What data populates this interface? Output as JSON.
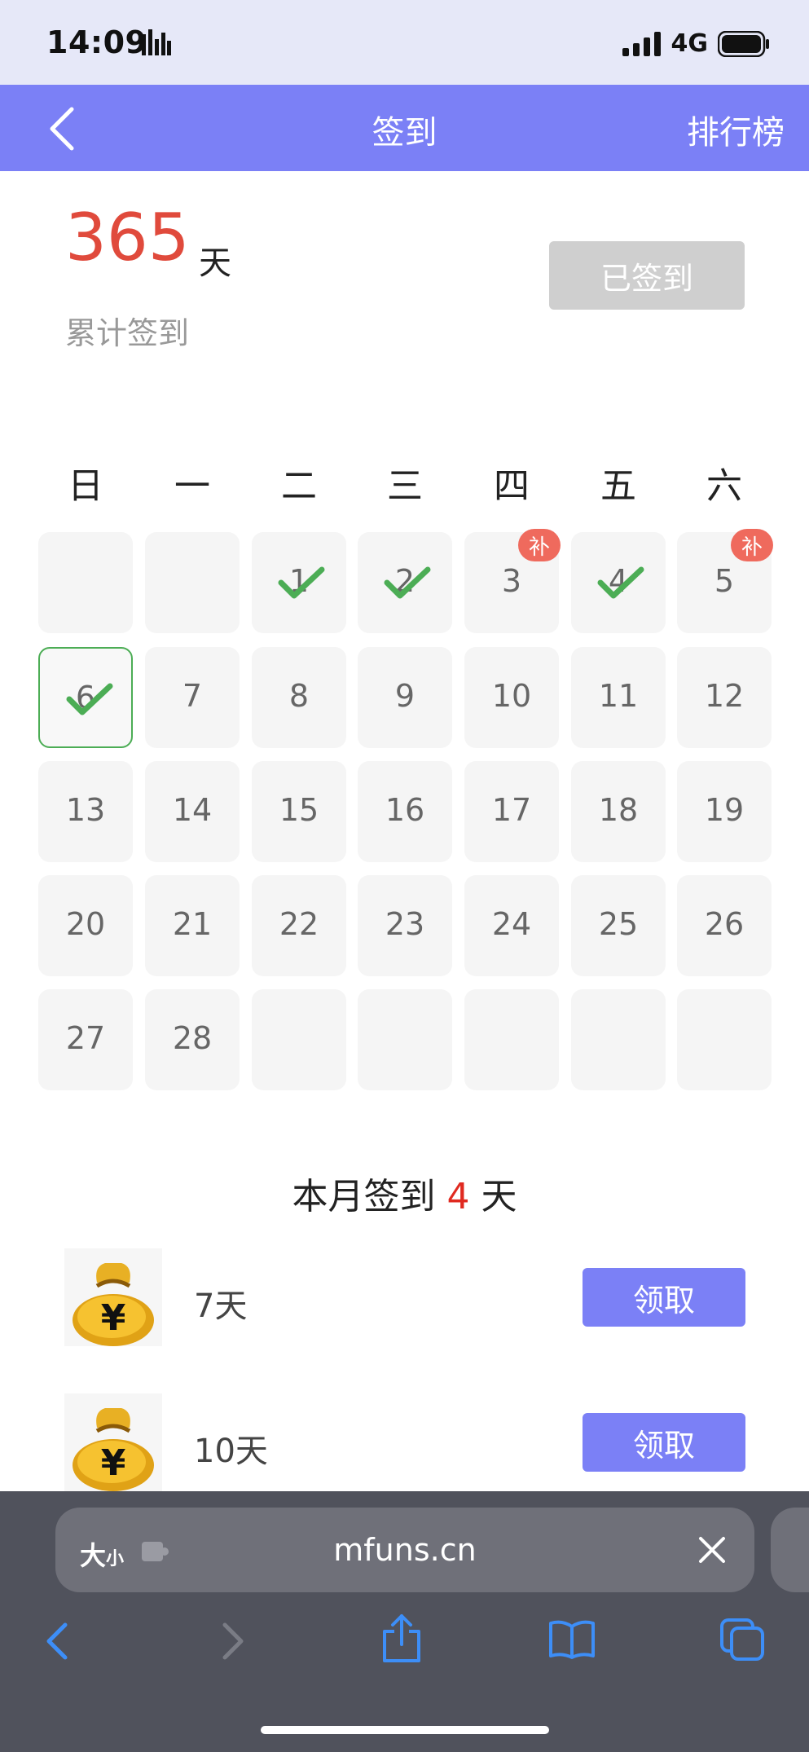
{
  "status_bar": {
    "time": "14:09",
    "network": "4G"
  },
  "header": {
    "title": "签到",
    "ranking_label": "排行榜"
  },
  "summary": {
    "total_days": "365",
    "unit": "天",
    "label": "累计签到",
    "button_label": "已签到"
  },
  "calendar": {
    "weekdays": [
      "日",
      "一",
      "二",
      "三",
      "四",
      "五",
      "六"
    ],
    "makeup_badge": "补",
    "days": [
      {
        "day": "",
        "checked": false,
        "makeup": false
      },
      {
        "day": "",
        "checked": false,
        "makeup": false
      },
      {
        "day": "1",
        "checked": true,
        "makeup": false
      },
      {
        "day": "2",
        "checked": true,
        "makeup": false
      },
      {
        "day": "3",
        "checked": false,
        "makeup": true
      },
      {
        "day": "4",
        "checked": true,
        "makeup": false
      },
      {
        "day": "5",
        "checked": false,
        "makeup": true
      },
      {
        "day": "6",
        "checked": true,
        "makeup": false,
        "today": true
      },
      {
        "day": "7"
      },
      {
        "day": "8"
      },
      {
        "day": "9"
      },
      {
        "day": "10"
      },
      {
        "day": "11"
      },
      {
        "day": "12"
      },
      {
        "day": "13"
      },
      {
        "day": "14"
      },
      {
        "day": "15"
      },
      {
        "day": "16"
      },
      {
        "day": "17"
      },
      {
        "day": "18"
      },
      {
        "day": "19"
      },
      {
        "day": "20"
      },
      {
        "day": "21"
      },
      {
        "day": "22"
      },
      {
        "day": "23"
      },
      {
        "day": "24"
      },
      {
        "day": "25"
      },
      {
        "day": "26"
      },
      {
        "day": "27"
      },
      {
        "day": "28"
      },
      {
        "day": ""
      },
      {
        "day": ""
      },
      {
        "day": ""
      },
      {
        "day": ""
      },
      {
        "day": ""
      }
    ]
  },
  "month_summary": {
    "prefix": "本月签到",
    "count": "4",
    "suffix": "天"
  },
  "rewards": [
    {
      "label": "7天",
      "button": "领取",
      "icon": "money-bag-icon"
    },
    {
      "label": "10天",
      "button": "领取",
      "icon": "money-bag-icon"
    }
  ],
  "browser": {
    "size_label_big": "大",
    "size_label_small": "小",
    "url": "mfuns.cn"
  },
  "colors": {
    "accent": "#7b80f6",
    "highlight_red": "#e04a3c",
    "check_green": "#4cad55",
    "makeup_badge": "#ef6a5d"
  }
}
